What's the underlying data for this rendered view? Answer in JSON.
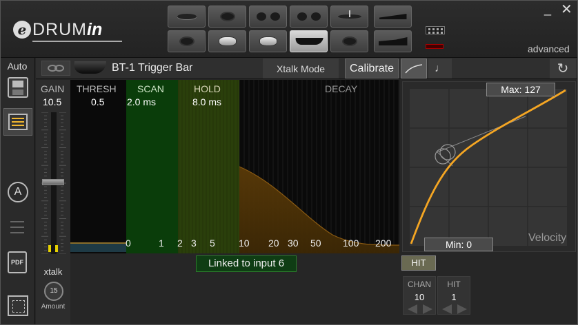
{
  "header": {
    "logo": {
      "e": "e",
      "drum": "DRUM",
      "in": "in"
    },
    "window": {
      "minimize": "_",
      "close": "✕"
    },
    "mode_label": "advanced",
    "pad_buttons_top": [
      {
        "icon": "cymbal-icon"
      },
      {
        "icon": "ride-icon"
      },
      {
        "icon": "dual-zone-icon"
      },
      {
        "icon": "dual-zone-icon"
      },
      {
        "icon": "hihat-icon"
      },
      {
        "icon": "ramp-icon"
      }
    ],
    "pad_buttons_bottom": [
      {
        "icon": "pad-icon"
      },
      {
        "icon": "snare-icon"
      },
      {
        "icon": "snare-icon"
      },
      {
        "icon": "trigger-bar-icon",
        "active": true
      },
      {
        "icon": "pad-icon"
      },
      {
        "icon": "pedal-icon"
      }
    ]
  },
  "sidebar": {
    "auto_label": "Auto",
    "items": [
      {
        "icon": "save-icon"
      },
      {
        "icon": "list-icon",
        "active": true
      },
      {
        "icon": "midi-a-icon",
        "text": "A"
      },
      {
        "icon": "lines-icon"
      },
      {
        "icon": "pdf-icon",
        "text": "PDF"
      },
      {
        "icon": "chip-icon"
      }
    ]
  },
  "toolbar": {
    "pad_name": "BT-1 Trigger Bar",
    "xtalk_mode": "Xtalk Mode",
    "calibrate": "Calibrate",
    "note_symbol": "♩",
    "refresh_symbol": "↻"
  },
  "params": {
    "gain": {
      "label": "GAIN",
      "value": "10.5"
    },
    "thresh": {
      "label": "THRESH",
      "value": "0.5"
    },
    "scan": {
      "label": "SCAN",
      "value": "2.0 ms"
    },
    "hold": {
      "label": "HOLD",
      "value": "8.0 ms"
    },
    "decay": {
      "label": "DECAY"
    }
  },
  "gain_slider": {
    "level": 0.51
  },
  "xtalk": {
    "label": "xtalk",
    "amount_value": "15",
    "amount_label": "Amount"
  },
  "time_axis": {
    "ticks": [
      "0",
      "1",
      "2",
      "3",
      "5",
      "10",
      "20",
      "30",
      "50",
      "100",
      "200"
    ]
  },
  "velocity": {
    "max_label": "Max: 127",
    "min_label": "Min: 0",
    "axis_label": "Velocity",
    "curve_color": "#f5a623"
  },
  "bottom": {
    "linked_text": "Linked to input 6",
    "hit_button": "HIT",
    "chan": {
      "label": "CHAN",
      "value": "10"
    },
    "hit": {
      "label": "HIT",
      "value": "1"
    }
  }
}
